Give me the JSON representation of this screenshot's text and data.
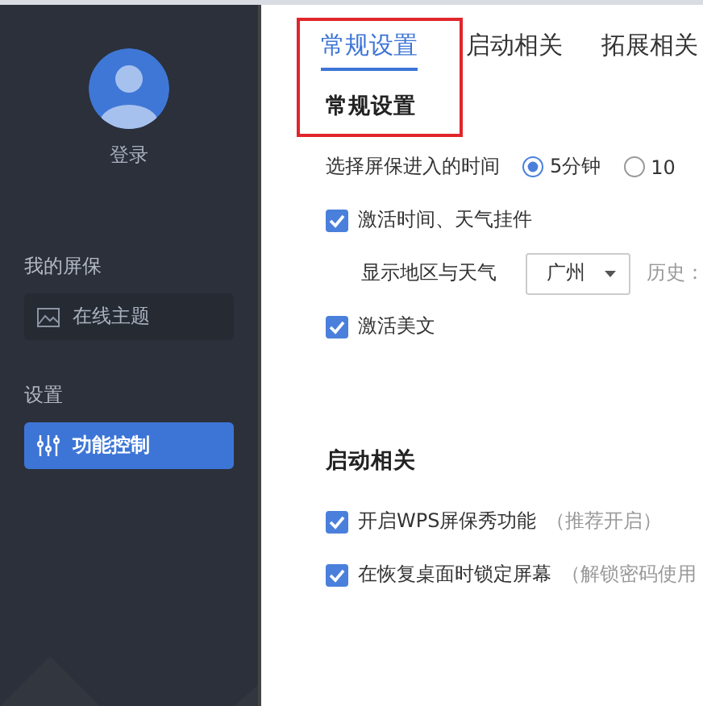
{
  "sidebar": {
    "login": "登录",
    "sections": [
      {
        "title": "我的屏保",
        "items": [
          {
            "label": "在线主题",
            "selected": false
          }
        ]
      },
      {
        "title": "设置",
        "items": [
          {
            "label": "功能控制",
            "selected": true
          }
        ]
      }
    ]
  },
  "tabs": [
    {
      "label": "常规设置",
      "selected": true
    },
    {
      "label": "启动相关",
      "selected": false
    },
    {
      "label": "拓展相关",
      "selected": false
    }
  ],
  "sections": [
    {
      "title": "常规设置",
      "rows": [
        {
          "kind": "radio",
          "label": "选择屏保进入的时间",
          "options": [
            {
              "label": "5分钟",
              "selected": true
            },
            {
              "label": "10",
              "selected": false
            }
          ]
        },
        {
          "kind": "checkbox",
          "label": "激活时间、天气挂件",
          "checked": true
        },
        {
          "kind": "select",
          "label": "显示地区与天气",
          "value": "广州",
          "extra": "历史："
        },
        {
          "kind": "checkbox",
          "label": "激活美文",
          "checked": true
        }
      ]
    },
    {
      "title": "启动相关",
      "rows": [
        {
          "kind": "checkbox",
          "label": "开启WPS屏保秀功能",
          "note": "（推荐开启）",
          "checked": true
        },
        {
          "kind": "checkbox",
          "label": "在恢复桌面时锁定屏幕",
          "note": "（解锁密码使用",
          "checked": true
        }
      ]
    }
  ]
}
